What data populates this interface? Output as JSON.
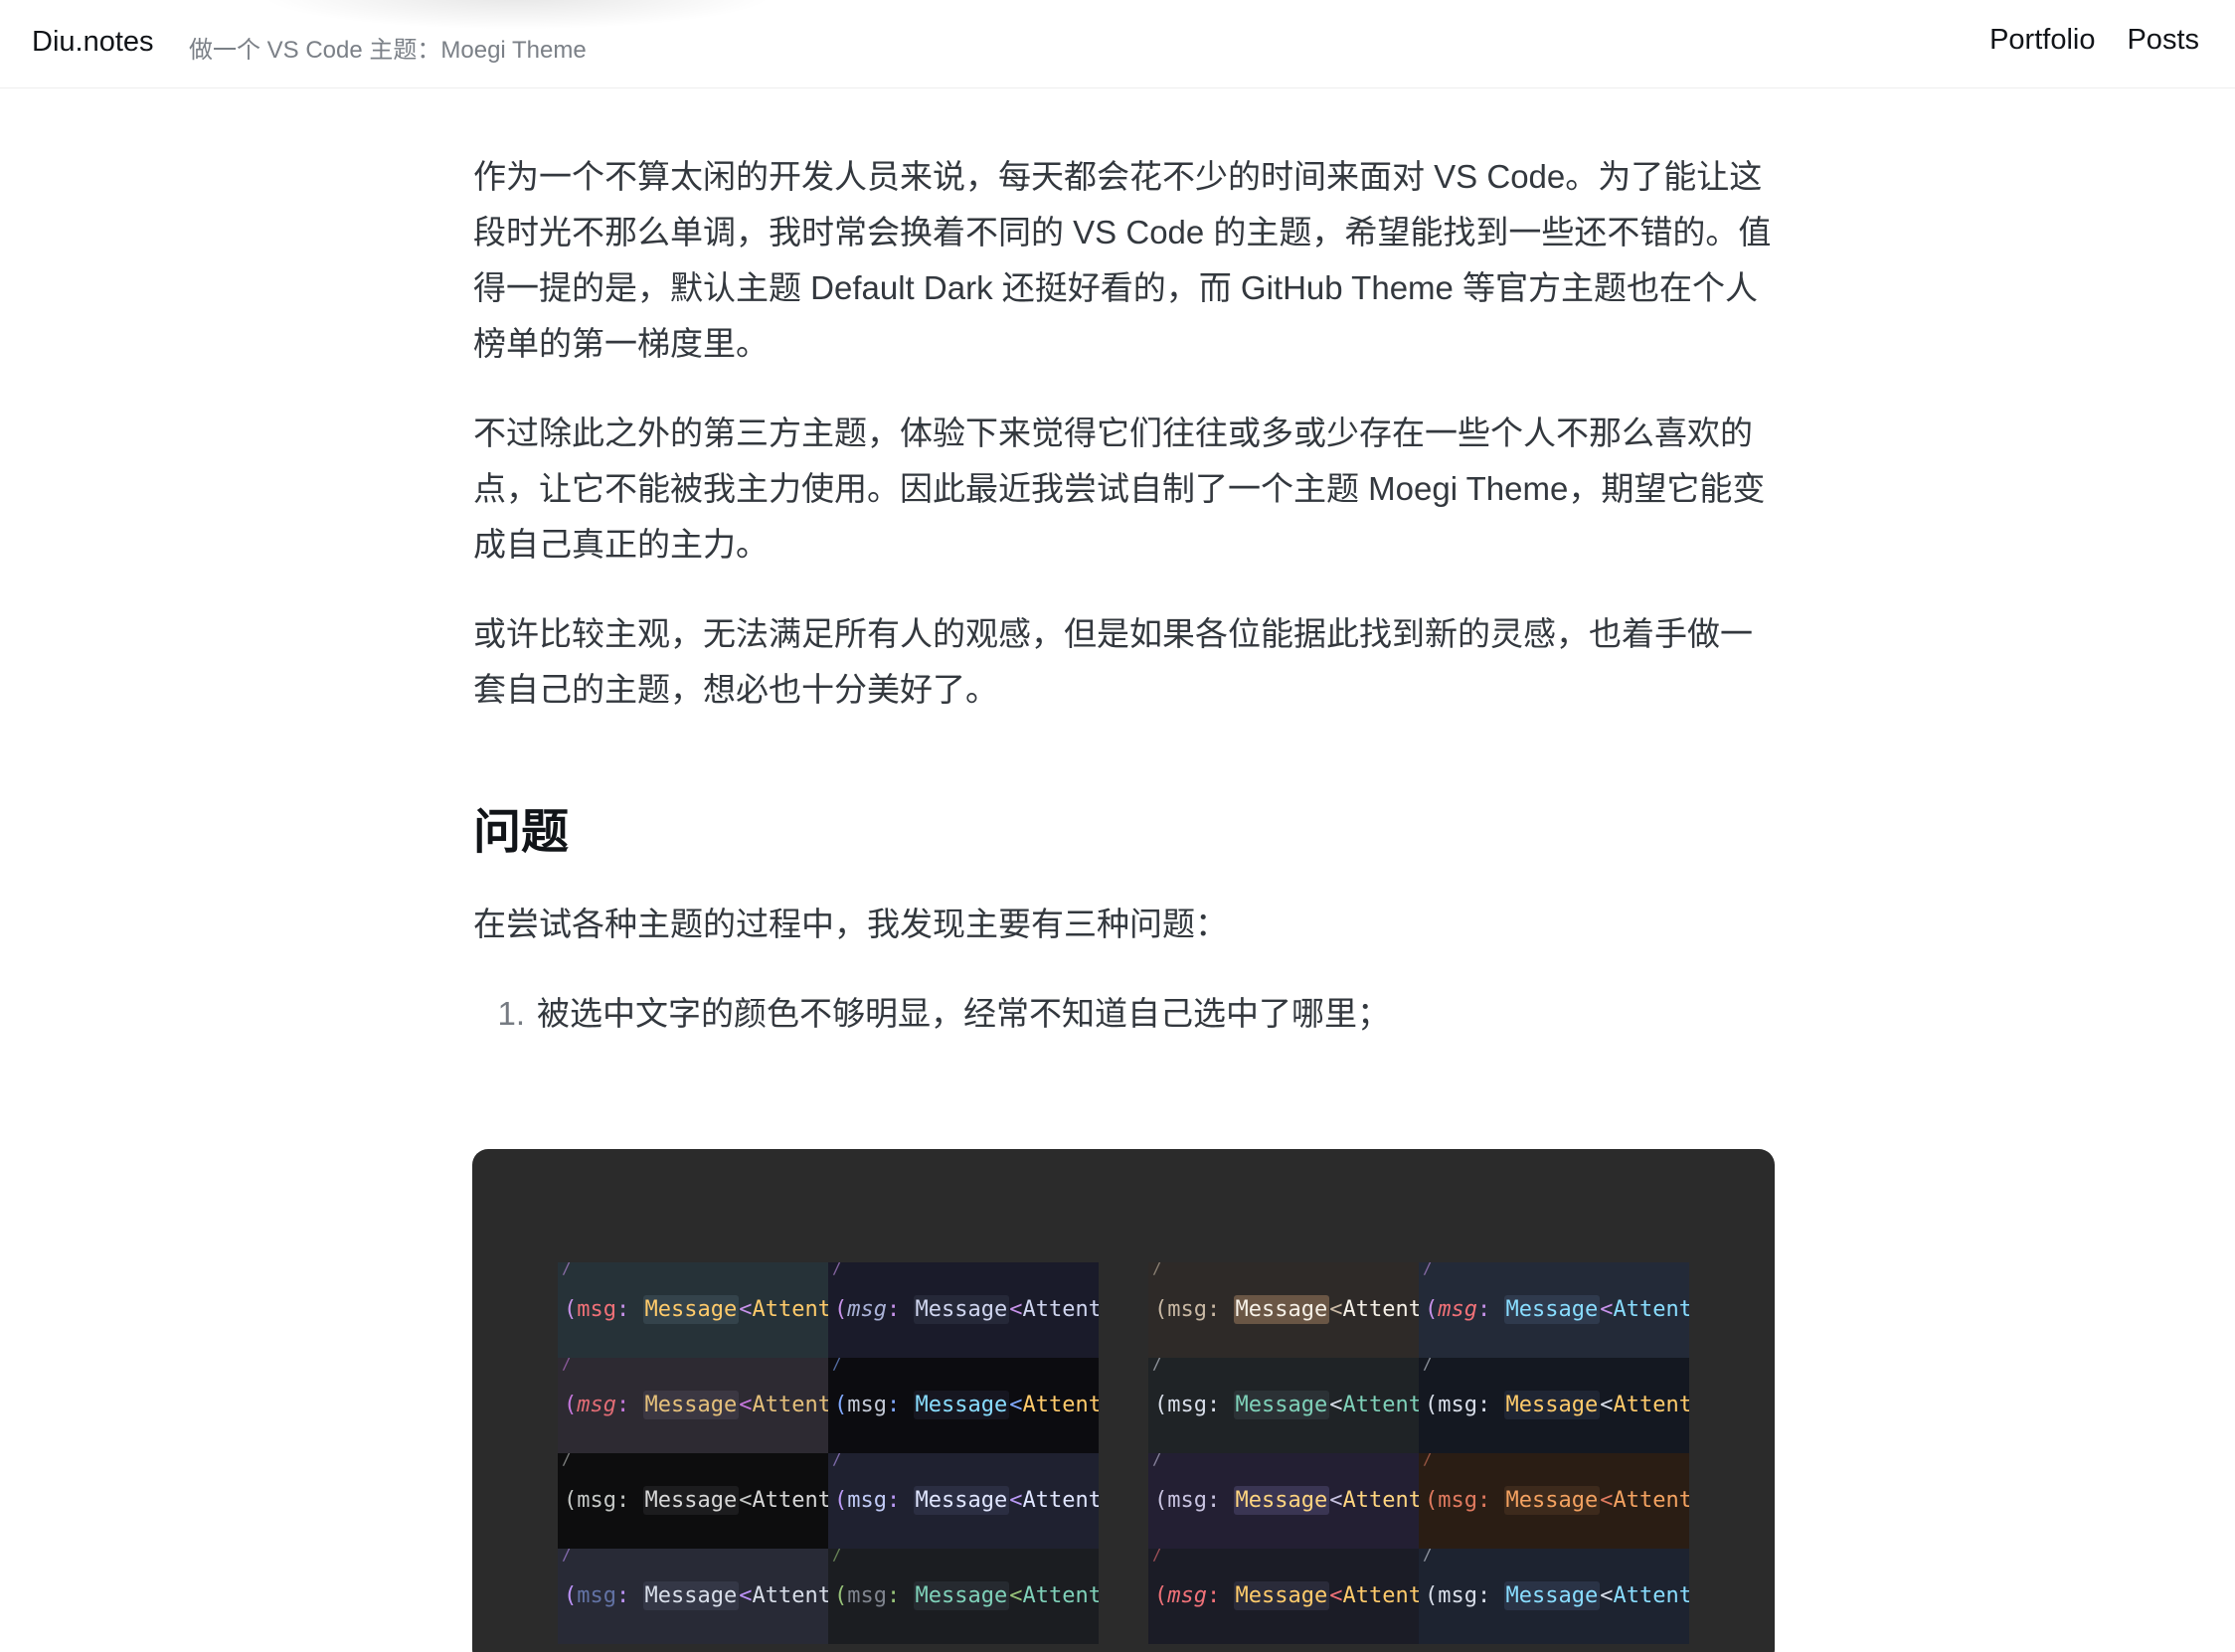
{
  "header": {
    "brand": "Diu.notes",
    "breadcrumb": "做一个 VS Code 主题：Moegi Theme",
    "nav": [
      "Portfolio",
      "Posts"
    ]
  },
  "article": {
    "paragraphs": [
      "作为一个不算太闲的开发人员来说，每天都会花不少的时间来面对 VS Code。为了能让这段时光不那么单调，我时常会换着不同的 VS Code 的主题，希望能找到一些还不错的。值得一提的是，默认主题 Default Dark 还挺好看的，而 GitHub Theme 等官方主题也在个人榜单的第一梯度里。",
      "不过除此之外的第三方主题，体验下来觉得它们往往或多或少存在一些个人不那么喜欢的点，让它不能被我主力使用。因此最近我尝试自制了一个主题 Moegi Theme，期望它能变成自己真正的主力。",
      "或许比较主观，无法满足所有人的观感，但是如果各位能据此找到新的灵感，也着手做一套自己的主题，想必也十分美好了。"
    ],
    "section_heading": "问题",
    "section_intro": "在尝试各种主题的过程中，我发现主要有三种问题：",
    "list": [
      {
        "num": "1.",
        "text": "被选中文字的颜色不够明显，经常不知道自己选中了哪里；"
      }
    ]
  },
  "figure": {
    "background": "#2b2b2b",
    "code": {
      "paren": "(",
      "param": "msg",
      "colon": ": ",
      "type": "Message",
      "lt": "<",
      "generic": "Attent"
    },
    "left_cells": [
      {
        "bg": "#263238",
        "paren": "#c792ea",
        "param": "#f07178",
        "type": "#ffcb6b",
        "generic": "#ffcb6b",
        "hl": "#34434b",
        "italic": false
      },
      {
        "bg": "#1a1b2a",
        "paren": "#c792ea",
        "param": "#a9b1d6",
        "type": "#d0d6f0",
        "generic": "#d0d6f0",
        "hl": "#252838",
        "italic": true
      },
      {
        "bg": "#2d2a32",
        "paren": "#c678dd",
        "param": "#e06c75",
        "type": "#e5c07b",
        "generic": "#e5c07b",
        "hl": "#3b3742",
        "italic": true
      },
      {
        "bg": "#0c0c10",
        "paren": "#82aaff",
        "param": "#c3c9d6",
        "type": "#89ddff",
        "generic": "#ffcb6b",
        "hl": "#161620",
        "italic": false
      },
      {
        "bg": "#0d0d0e",
        "paren": "#c5c8c6",
        "param": "#c5c8c6",
        "type": "#d7d7d7",
        "generic": "#d7d7d7",
        "hl": "#1c1c1e",
        "italic": false
      },
      {
        "bg": "#1f2130",
        "paren": "#bb9af7",
        "param": "#c0caf5",
        "type": "#e0e6ff",
        "generic": "#e0e6ff",
        "hl": "#2b2e42",
        "italic": false
      },
      {
        "bg": "#282a36",
        "paren": "#bd93f9",
        "param": "#6272a4",
        "type": "#d8dee9",
        "generic": "#d8dee9",
        "hl": "#343746",
        "italic": false
      },
      {
        "bg": "#1b1d21",
        "paren": "#98c379",
        "param": "#7f848e",
        "type": "#7fd1b9",
        "generic": "#7fd1b9",
        "hl": "#262a30",
        "italic": false
      }
    ],
    "right_cells": [
      {
        "bg": "#2e2a28",
        "paren": "#c8b8a4",
        "param": "#c8b8a4",
        "type": "#f6f1e8",
        "generic": "#f6f1e8",
        "hl": "#6a5645",
        "italic": false
      },
      {
        "bg": "#232a38",
        "paren": "#c792ea",
        "param": "#f07178",
        "type": "#89ddff",
        "generic": "#89ddff",
        "hl": "#2f3a4d",
        "italic": true
      },
      {
        "bg": "#1f2326",
        "paren": "#d8dee9",
        "param": "#d8dee9",
        "type": "#7fd1b9",
        "generic": "#7fd1b9",
        "hl": "#2b3135",
        "italic": false
      },
      {
        "bg": "#141821",
        "paren": "#d8dee9",
        "param": "#d8dee9",
        "type": "#ffcb6b",
        "generic": "#ffcb6b",
        "hl": "#1f2533",
        "italic": false
      },
      {
        "bg": "#231f33",
        "paren": "#c8c3e0",
        "param": "#c8c3e0",
        "type": "#ffd580",
        "generic": "#ffd580",
        "hl": "#3a3553",
        "italic": false
      },
      {
        "bg": "#2a1d14",
        "paren": "#e07a5f",
        "param": "#e07a5f",
        "type": "#f4a261",
        "generic": "#f4a261",
        "hl": "#3d2a1c",
        "italic": false
      },
      {
        "bg": "#1b1c26",
        "paren": "#f07178",
        "param": "#f07178",
        "type": "#ffcb6b",
        "generic": "#ffcb6b",
        "hl": "#2a2b3a",
        "italic": true
      },
      {
        "bg": "#1d2330",
        "paren": "#d8dee9",
        "param": "#d8dee9",
        "type": "#89ddff",
        "generic": "#89ddff",
        "hl": "#2a3346",
        "italic": false
      }
    ]
  }
}
